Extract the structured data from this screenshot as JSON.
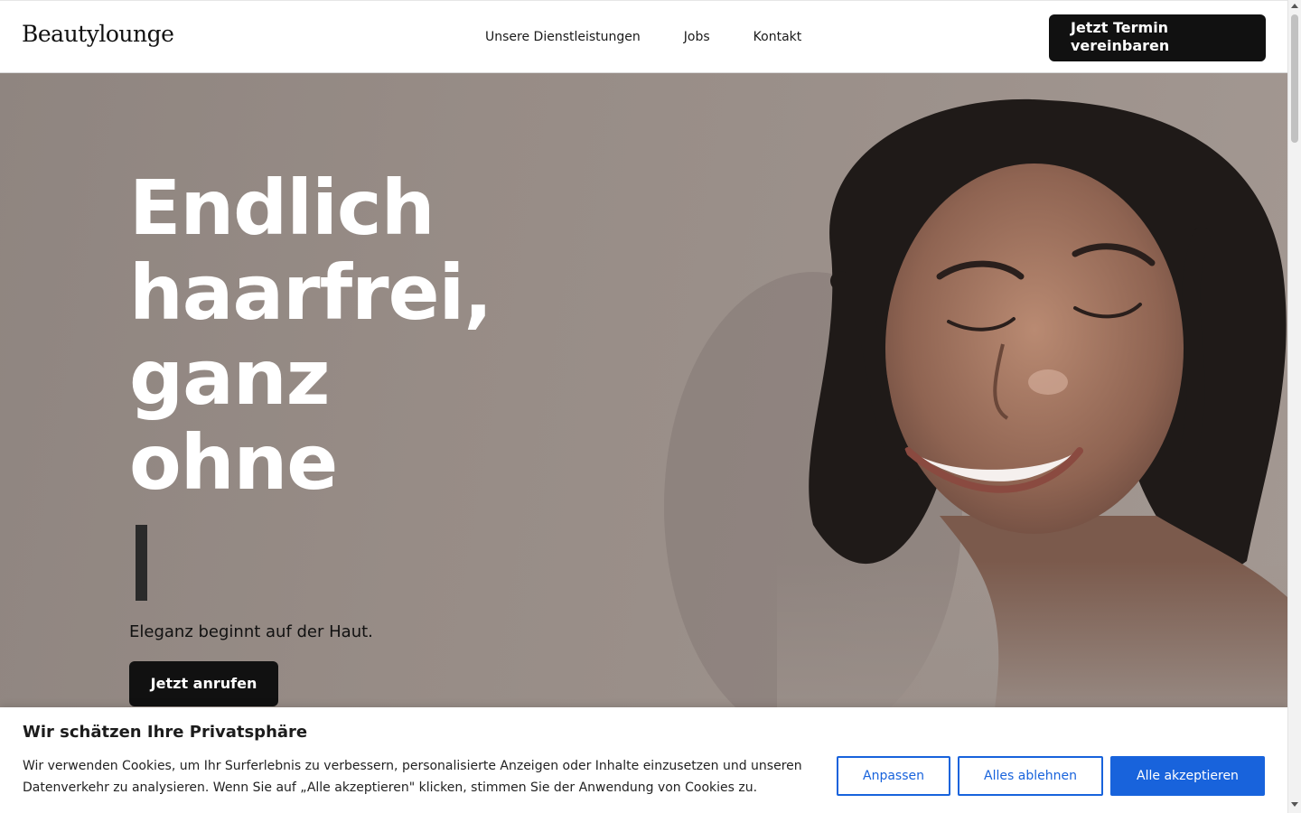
{
  "header": {
    "logo": "Beautylounge",
    "nav": [
      "Unsere Dienstleistungen",
      "Jobs",
      "Kontakt"
    ],
    "cta": "Jetzt Termin vereinbaren"
  },
  "hero": {
    "headline_lines": [
      "Endlich",
      "haarfrei,",
      "ganz",
      "ohne"
    ],
    "tagline": "Eleganz beginnt auf der Haut.",
    "cta": "Jetzt anrufen"
  },
  "cookie": {
    "title": "Wir schätzen Ihre Privatsphäre",
    "text": "Wir verwenden Cookies, um Ihr Surferlebnis zu verbessern, personalisierte Anzeigen oder Inhalte einzusetzen und unseren Datenverkehr zu analysieren. Wenn Sie auf „Alle akzeptieren\" klicken, stimmen Sie der Anwendung von Cookies zu.",
    "customize": "Anpassen",
    "reject": "Alles ablehnen",
    "accept": "Alle akzeptieren"
  },
  "colors": {
    "primary_dark": "#111111",
    "consent_blue": "#1863dc",
    "hero_bg": "#978c86"
  }
}
